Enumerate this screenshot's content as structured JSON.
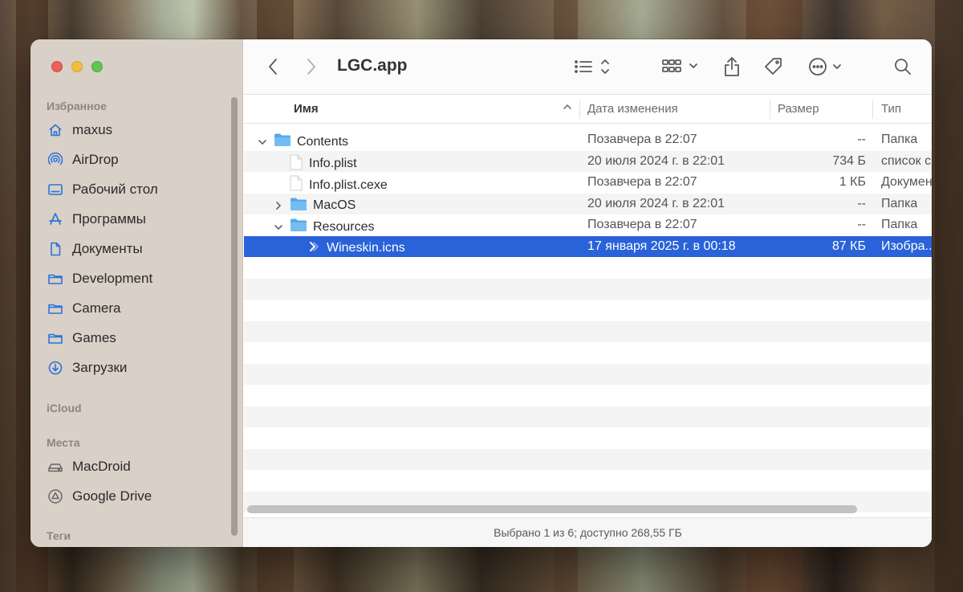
{
  "window": {
    "title": "LGC.app"
  },
  "sidebar": {
    "sections": [
      {
        "title": "Избранное"
      },
      {
        "title": "iCloud"
      },
      {
        "title": "Места"
      },
      {
        "title": "Теги"
      }
    ],
    "favorites": [
      {
        "label": "maxus",
        "icon": "home-icon"
      },
      {
        "label": "AirDrop",
        "icon": "airdrop-icon"
      },
      {
        "label": "Рабочий стол",
        "icon": "desktop-icon"
      },
      {
        "label": "Программы",
        "icon": "applications-icon"
      },
      {
        "label": "Документы",
        "icon": "document-icon"
      },
      {
        "label": "Development",
        "icon": "folder-icon"
      },
      {
        "label": "Camera",
        "icon": "folder-icon"
      },
      {
        "label": "Games",
        "icon": "folder-icon"
      },
      {
        "label": "Загрузки",
        "icon": "downloads-icon"
      }
    ],
    "locations": [
      {
        "label": "MacDroid",
        "icon": "drive-icon"
      },
      {
        "label": "Google Drive",
        "icon": "google-drive-icon"
      }
    ]
  },
  "columns": {
    "name": "Имя",
    "date": "Дата изменения",
    "size": "Размер",
    "kind": "Тип"
  },
  "files": [
    {
      "name": "Contents",
      "date": "Позавчера в 22:07",
      "size": "--",
      "kind": "Папка",
      "type": "folder",
      "expanded": true,
      "depth": 0
    },
    {
      "name": "Info.plist",
      "date": "20 июля 2024 г. в 22:01",
      "size": "734 Б",
      "kind": "список с",
      "type": "file",
      "depth": 1
    },
    {
      "name": "Info.plist.cexe",
      "date": "Позавчера в 22:07",
      "size": "1 КБ",
      "kind": "Докумен",
      "type": "file",
      "depth": 1
    },
    {
      "name": "MacOS",
      "date": "20 июля 2024 г. в 22:01",
      "size": "--",
      "kind": "Папка",
      "type": "folder",
      "expanded": false,
      "depth": 1
    },
    {
      "name": "Resources",
      "date": "Позавчера в 22:07",
      "size": "--",
      "kind": "Папка",
      "type": "folder",
      "expanded": true,
      "depth": 1
    },
    {
      "name": "Wineskin.icns",
      "date": "17 января 2025 г. в 00:18",
      "size": "87 КБ",
      "kind": "Изобра...",
      "type": "icns",
      "depth": 2,
      "selected": true
    }
  ],
  "status": {
    "text": "Выбрано 1 из 6; доступно 268,55 ГБ"
  },
  "colors": {
    "selection": "#2a62d9",
    "folder": "#5aa9e6"
  }
}
